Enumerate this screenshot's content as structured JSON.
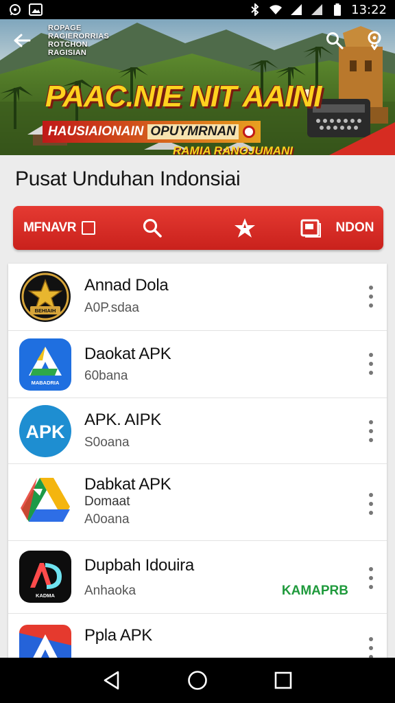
{
  "status_bar": {
    "time": "13:22",
    "left_icons": [
      "whatsapp-icon",
      "gallery-icon"
    ],
    "right_icons": [
      "bluetooth-icon",
      "wifi-icon",
      "signal-icon",
      "signal-icon",
      "battery-icon"
    ]
  },
  "banner": {
    "small_text": "ROPAGE RAGIERORRIAS ROTCHON RAGISIAN",
    "headline": "PAAC.NIE NIT AAINI",
    "sub_line_1": "HAUSIAIONAIN",
    "sub_line_1_highlight": "OPUYMRNAN",
    "sub_line_2": "RAMIA RANOJUMANI"
  },
  "page_title": "Pusat Unduhan Indonsiai",
  "tabs": [
    {
      "label": "MFNAVR",
      "icon": "square-icon"
    },
    {
      "label": "",
      "icon": "search-icon"
    },
    {
      "label": "",
      "icon": "star-icon"
    },
    {
      "label": "NDON",
      "icon": "gallery-icon"
    }
  ],
  "apps": [
    {
      "name": "Annad Dola",
      "sub": "A0P.sdaa",
      "extra": "",
      "tag": "",
      "icon": "star-badge-icon",
      "icon_text": "BEHIAIH"
    },
    {
      "name": "Daokat APK",
      "sub": "60bana",
      "extra": "",
      "tag": "",
      "icon": "blue-triangle-icon",
      "icon_text": "MABADRIA"
    },
    {
      "name": "APK. AIPK",
      "sub": "S0oana",
      "extra": "",
      "tag": "",
      "icon": "apk-circle-icon",
      "icon_text": "APK"
    },
    {
      "name": "Dabkat APK",
      "sub": "A0oana",
      "extra": "Domaat",
      "tag": "",
      "icon": "drive-triangle-icon",
      "icon_text": ""
    },
    {
      "name": "Dupbah Idouira",
      "sub": "Anhaoka",
      "extra": "",
      "tag": "KAMAPRB",
      "icon": "ad-logo-icon",
      "icon_text": "KADMA"
    },
    {
      "name": "Ppla APK",
      "sub": "",
      "extra": "",
      "tag": "",
      "icon": "red-blue-triangle-icon",
      "icon_text": ""
    }
  ],
  "colors": {
    "accent_red": "#d82a24",
    "tag_green": "#1f9a3c"
  }
}
